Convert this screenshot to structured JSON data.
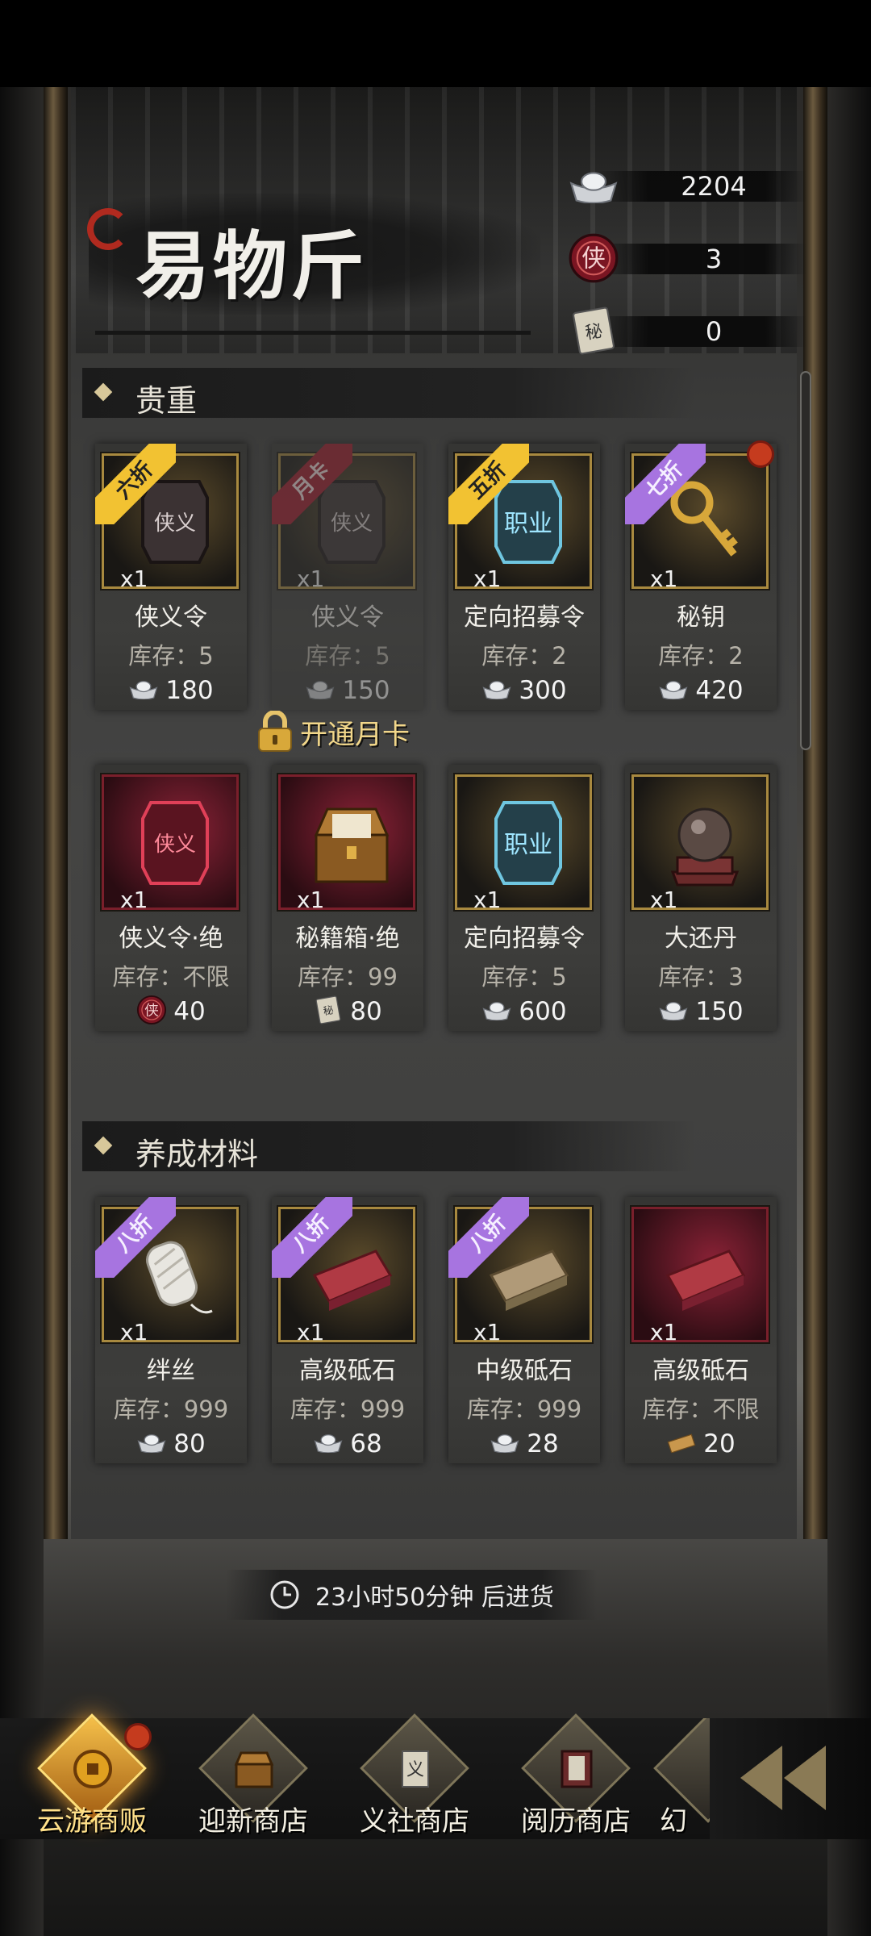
{
  "header": {
    "title": "易物斤",
    "currencies": [
      {
        "icon": "silver-ingot-icon",
        "value": "2204"
      },
      {
        "icon": "xia-token-icon",
        "value": "3"
      },
      {
        "icon": "secret-book-icon",
        "value": "0"
      }
    ]
  },
  "sections": [
    {
      "title": "贵重",
      "items": [
        {
          "tag": "六折",
          "tag_color": "yellow",
          "qty": "x1",
          "name": "侠义令",
          "stock": "库存：5",
          "price": "180",
          "currency": "silver-ingot-icon",
          "art": "token-dark"
        },
        {
          "tag": "月卡",
          "tag_color": "red",
          "qty": "x1",
          "name": "侠义令",
          "stock": "库存：5",
          "price": "150",
          "currency": "silver-ingot-icon",
          "art": "token-dark",
          "locked": true
        },
        {
          "tag": "五折",
          "tag_color": "yellow",
          "qty": "x1",
          "name": "定向招募令",
          "stock": "库存：2",
          "price": "300",
          "currency": "silver-ingot-icon",
          "art": "token-blue"
        },
        {
          "tag": "七折",
          "tag_color": "purple",
          "qty": "x1",
          "name": "秘钥",
          "stock": "库存：2",
          "price": "420",
          "currency": "silver-ingot-icon",
          "art": "key",
          "red_dot": true
        },
        {
          "tag": "",
          "qty": "x1",
          "name": "侠义令·绝",
          "stock": "库存：不限",
          "price": "40",
          "currency": "xia-token-icon",
          "art": "token-red",
          "red_bg": true
        },
        {
          "tag": "",
          "qty": "x1",
          "name": "秘籍箱·绝",
          "stock": "库存：99",
          "price": "80",
          "currency": "secret-book-icon",
          "art": "chest",
          "red_bg": true
        },
        {
          "tag": "",
          "qty": "x1",
          "name": "定向招募令",
          "stock": "库存：5",
          "price": "600",
          "currency": "silver-ingot-icon",
          "art": "token-blue"
        },
        {
          "tag": "",
          "qty": "x1",
          "name": "大还丹",
          "stock": "库存：3",
          "price": "150",
          "currency": "silver-ingot-icon",
          "art": "pill"
        }
      ]
    },
    {
      "title": "养成材料",
      "items": [
        {
          "tag": "八折",
          "tag_color": "purple",
          "qty": "x1",
          "name": "绊丝",
          "stock": "库存：999",
          "price": "80",
          "currency": "silver-ingot-icon",
          "art": "thread"
        },
        {
          "tag": "八折",
          "tag_color": "purple",
          "qty": "x1",
          "name": "高级砥石",
          "stock": "库存：999",
          "price": "68",
          "currency": "silver-ingot-icon",
          "art": "stone-red"
        },
        {
          "tag": "八折",
          "tag_color": "purple",
          "qty": "x1",
          "name": "中级砥石",
          "stock": "库存：999",
          "price": "28",
          "currency": "silver-ingot-icon",
          "art": "stone-tan"
        },
        {
          "tag": "",
          "qty": "x1",
          "name": "高级砥石",
          "stock": "库存：不限",
          "price": "20",
          "currency": "bronze-ingot-icon",
          "art": "stone-red",
          "red_bg": true
        }
      ]
    }
  ],
  "lock_notice": "开通月卡",
  "restock": {
    "text": "23小时50分钟 后进货",
    "icon": "clock-icon"
  },
  "nav": [
    {
      "label": "云游商贩",
      "active": true,
      "icon": "coin-vendor-icon"
    },
    {
      "label": "迎新商店",
      "active": false,
      "icon": "treasure-chest-icon"
    },
    {
      "label": "义社商店",
      "active": false,
      "icon": "scroll-icon"
    },
    {
      "label": "阅历商店",
      "active": false,
      "icon": "book-icon"
    },
    {
      "label": "幻",
      "active": false,
      "icon": "illusion-icon"
    }
  ],
  "colors": {
    "accent_gold": "#f2c232",
    "accent_purple": "#a774e0",
    "accent_red": "#a3192b"
  }
}
